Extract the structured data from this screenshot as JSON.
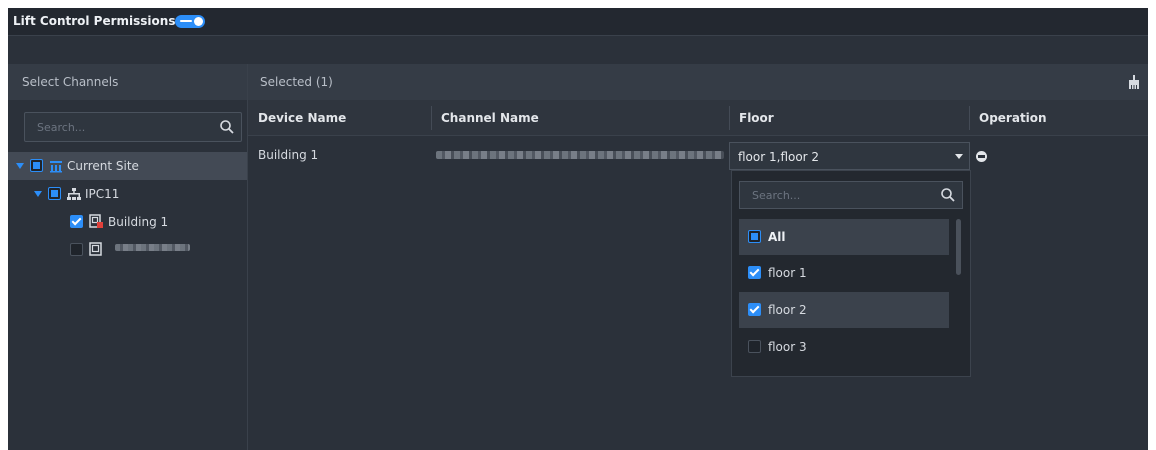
{
  "header": {
    "title": "Lift Control Permissions",
    "toggle_on": true
  },
  "left_panel": {
    "title": "Select Channels",
    "search_placeholder": "Search...",
    "tree": [
      {
        "label": "Current Site",
        "state": "partial",
        "icon": "site-icon"
      },
      {
        "label": "IPC11",
        "state": "partial",
        "icon": "device-tree-icon"
      },
      {
        "label": "Building 1",
        "state": "checked",
        "icon": "lift-channel-icon"
      },
      {
        "label": "",
        "state": "unchecked",
        "icon": "lift-channel-icon"
      }
    ]
  },
  "right_panel": {
    "selected_label": "Selected (1)",
    "columns": [
      "Device Name",
      "Channel Name",
      "Floor",
      "Operation"
    ],
    "rows": [
      {
        "device_name": "Building 1",
        "channel_name": "",
        "floor": "floor 1,floor 2"
      }
    ]
  },
  "floor_dropdown": {
    "search_placeholder": "Search...",
    "options": [
      {
        "label": "All",
        "state": "partial"
      },
      {
        "label": "floor 1",
        "state": "checked"
      },
      {
        "label": "floor 2",
        "state": "checked"
      },
      {
        "label": "floor 3",
        "state": "unchecked"
      }
    ]
  },
  "colors": {
    "accent": "#2c8ef8",
    "background": "#2b313a",
    "header": "#232830"
  }
}
